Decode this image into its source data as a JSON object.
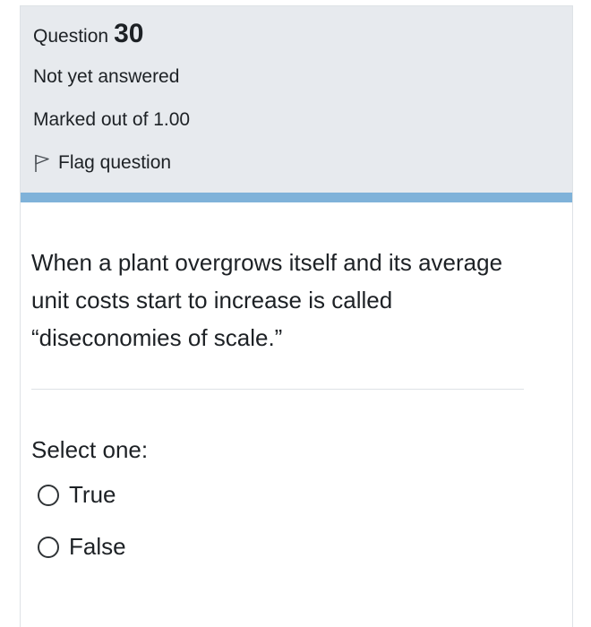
{
  "question_info": {
    "question_word": "Question",
    "question_number": "30",
    "state": "Not yet answered",
    "grade": "Marked out of 1.00",
    "flag_label": "Flag question",
    "flag_icon": "flag-icon"
  },
  "colors": {
    "info_background": "#e7eaee",
    "accent_bar": "#7fb2d9",
    "text": "#1d2125"
  },
  "question": {
    "text": "When a plant overgrows itself and its average unit costs start to increase is called “diseconomies of scale.”",
    "prompt": "Select one:",
    "options": [
      {
        "label": "True",
        "selected": false
      },
      {
        "label": "False",
        "selected": false
      }
    ]
  }
}
